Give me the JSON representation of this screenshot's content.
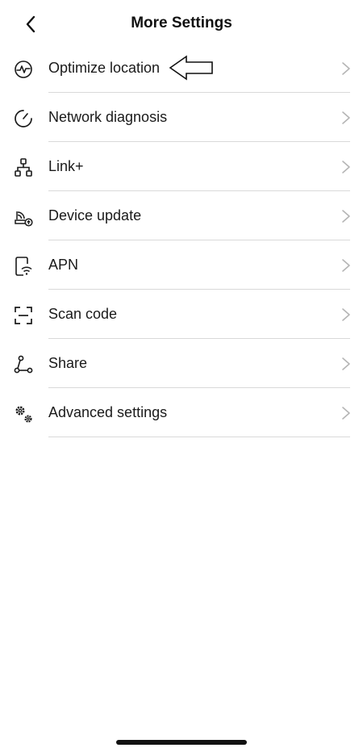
{
  "header": {
    "title": "More Settings",
    "back_icon": "chevron-left-icon"
  },
  "menu": {
    "items": [
      {
        "id": "optimize-location",
        "label": "Optimize location",
        "icon": "signal-wave-icon"
      },
      {
        "id": "network-diagnosis",
        "label": "Network diagnosis",
        "icon": "diagnosis-gauge-icon"
      },
      {
        "id": "link-plus",
        "label": "Link+",
        "icon": "network-topology-icon"
      },
      {
        "id": "device-update",
        "label": "Device update",
        "icon": "router-update-icon"
      },
      {
        "id": "apn",
        "label": "APN",
        "icon": "phone-wifi-icon"
      },
      {
        "id": "scan-code",
        "label": "Scan code",
        "icon": "scan-frame-icon"
      },
      {
        "id": "share",
        "label": "Share",
        "icon": "share-nodes-icon"
      },
      {
        "id": "advanced-settings",
        "label": "Advanced settings",
        "icon": "gears-icon"
      }
    ]
  },
  "colors": {
    "text": "#1a1a1a",
    "divider": "#d9d9d9",
    "chevron": "#b5b5b5",
    "background": "#ffffff"
  }
}
